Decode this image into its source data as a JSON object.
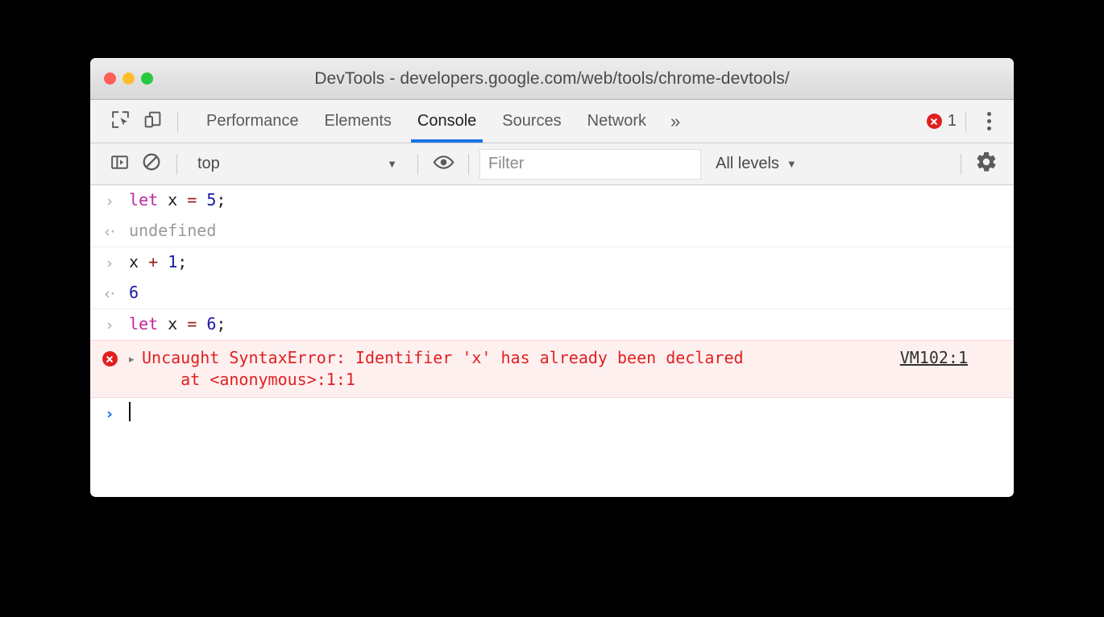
{
  "window": {
    "title": "DevTools - developers.google.com/web/tools/chrome-devtools/",
    "traffic_lights": [
      "close",
      "minimize",
      "maximize"
    ],
    "accent_blue": "#1a73e8",
    "error_red": "#e02020",
    "error_row_bg": "#fff0f0"
  },
  "tabbar": {
    "inspect_icon": "inspect-element-icon",
    "device_icon": "device-toolbar-icon",
    "tabs": [
      {
        "label": "Performance",
        "selected": false
      },
      {
        "label": "Elements",
        "selected": false
      },
      {
        "label": "Console",
        "selected": true
      },
      {
        "label": "Sources",
        "selected": false
      },
      {
        "label": "Network",
        "selected": false
      }
    ],
    "more_tabs": "»",
    "error_count": "1",
    "error_icon": "error-circle-icon",
    "menu_icon": "kebab-menu-icon"
  },
  "console_toolbar": {
    "sidebar_icon": "console-sidebar-icon",
    "clear_icon": "clear-console-icon",
    "context": "top",
    "context_caret": "▼",
    "eye_icon": "live-expression-eye-icon",
    "filter_placeholder": "Filter",
    "filter_value": "",
    "levels_label": "All levels",
    "levels_caret": "▼",
    "settings_icon": "settings-gear-icon"
  },
  "console": {
    "input_marker": "›",
    "output_marker": "‹·",
    "entries": [
      {
        "kind": "input",
        "tokens": [
          {
            "t": "let",
            "c": "kw"
          },
          {
            "t": " x ",
            "c": ""
          },
          {
            "t": "=",
            "c": "op"
          },
          {
            "t": " ",
            "c": ""
          },
          {
            "t": "5",
            "c": "num"
          },
          {
            "t": ";",
            "c": ""
          }
        ]
      },
      {
        "kind": "output",
        "tokens": [
          {
            "t": "undefined",
            "c": "muted"
          }
        ]
      },
      {
        "kind": "input",
        "tokens": [
          {
            "t": "x ",
            "c": ""
          },
          {
            "t": "+",
            "c": "op"
          },
          {
            "t": " ",
            "c": ""
          },
          {
            "t": "1",
            "c": "num"
          },
          {
            "t": ";",
            "c": ""
          }
        ]
      },
      {
        "kind": "output",
        "tokens": [
          {
            "t": "6",
            "c": "num"
          }
        ]
      },
      {
        "kind": "input",
        "tokens": [
          {
            "t": "let",
            "c": "kw"
          },
          {
            "t": " x ",
            "c": ""
          },
          {
            "t": "=",
            "c": "op"
          },
          {
            "t": " ",
            "c": ""
          },
          {
            "t": "6",
            "c": "num"
          },
          {
            "t": ";",
            "c": ""
          }
        ]
      }
    ],
    "error": {
      "icon": "error-circle-icon",
      "disclosure": "▸",
      "line1": "Uncaught SyntaxError: Identifier 'x' has already been declared",
      "line2": "    at <anonymous>:1:1",
      "source_link": "VM102:1"
    },
    "prompt": {
      "marker": "›",
      "value": ""
    }
  }
}
